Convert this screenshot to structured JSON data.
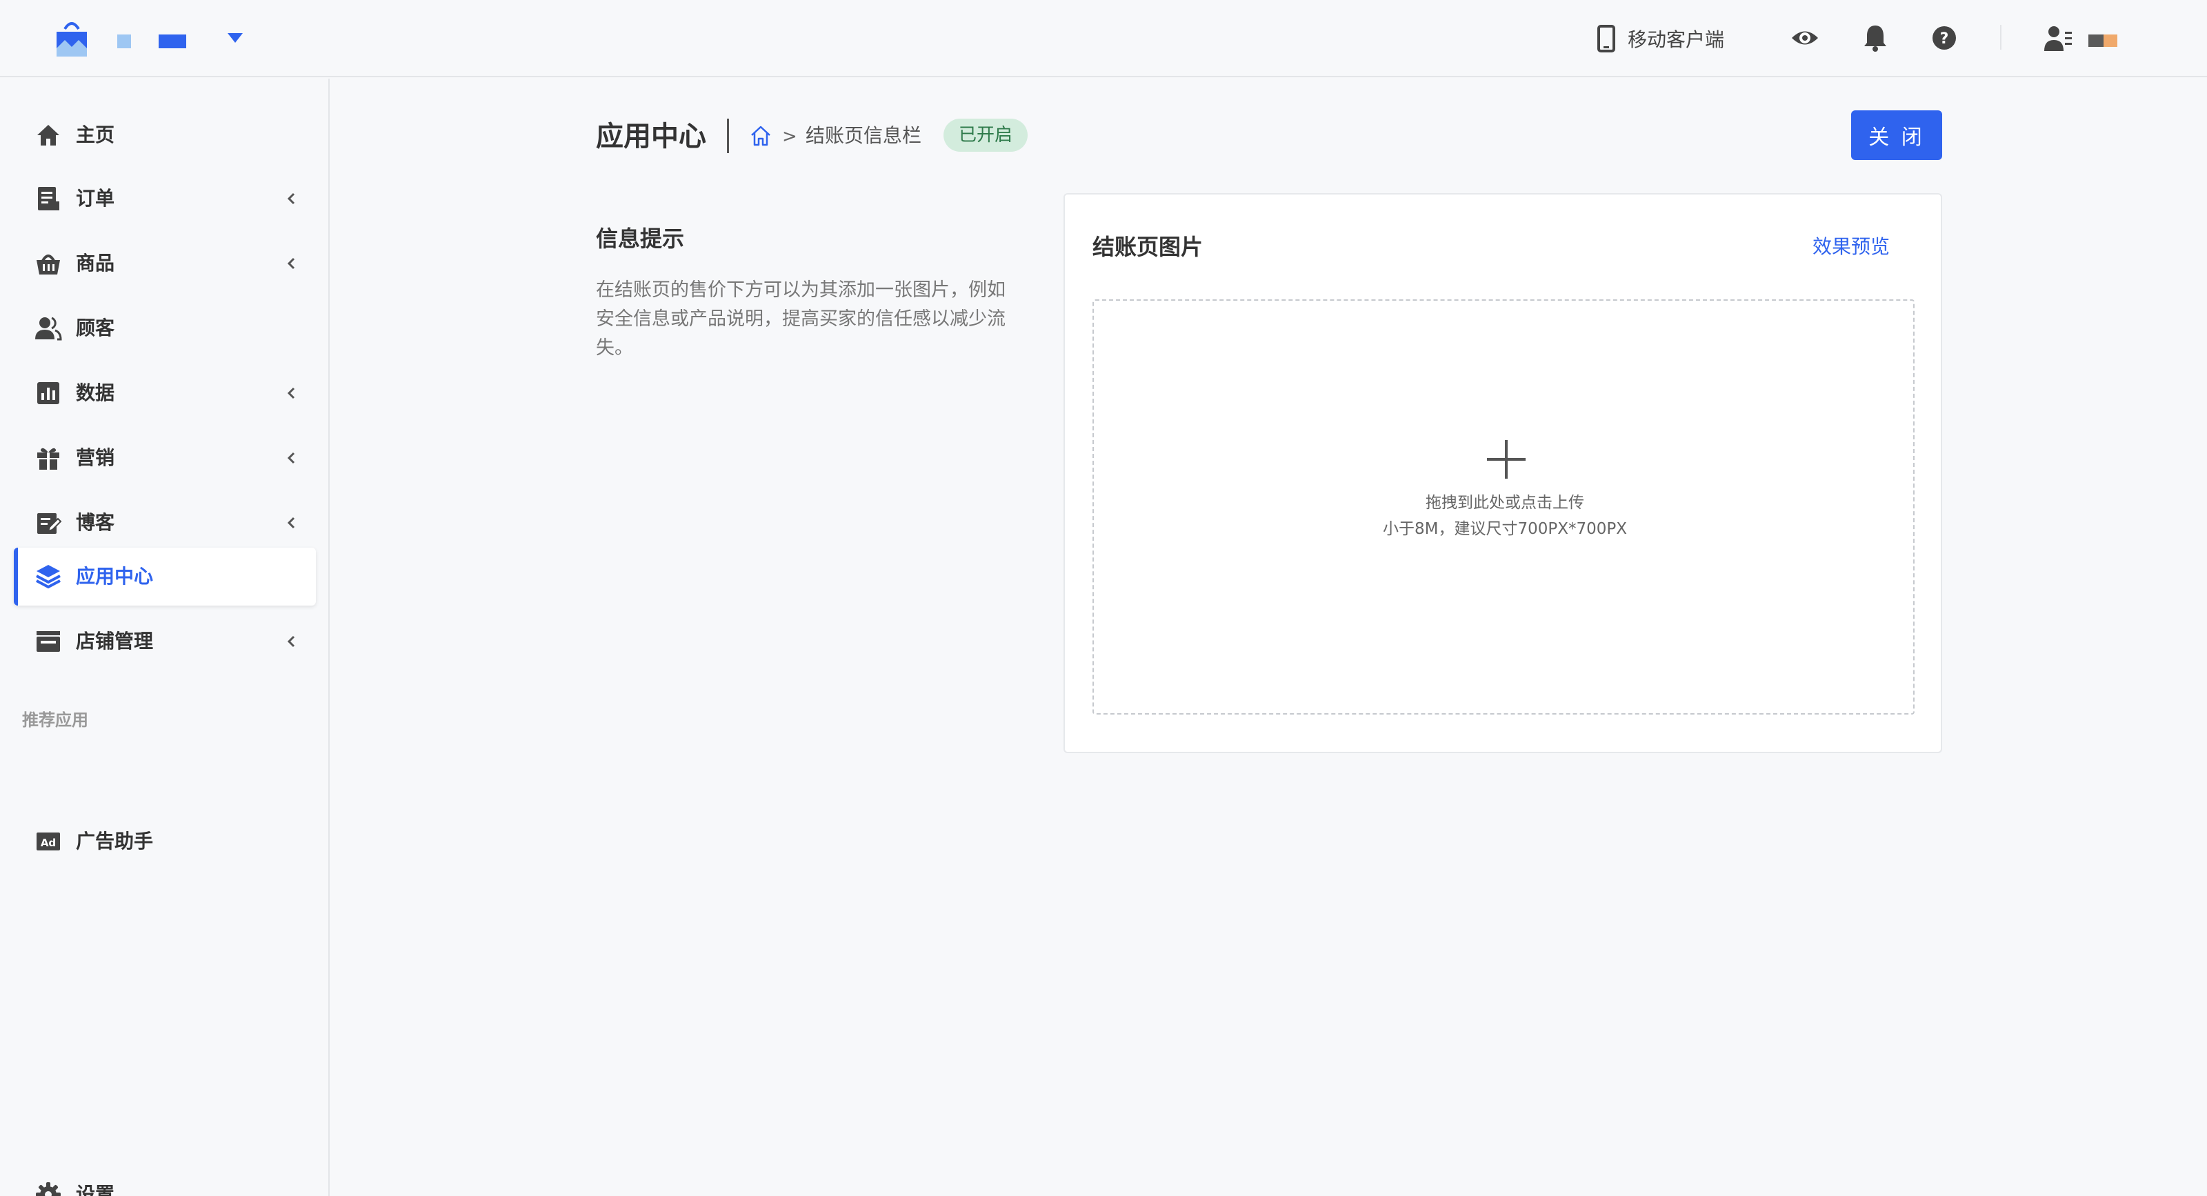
{
  "header": {
    "mobile_client_label": "移动客户端"
  },
  "sidebar": {
    "items": [
      {
        "label": "主页",
        "icon": "home-icon"
      },
      {
        "label": "订单",
        "icon": "order-icon"
      },
      {
        "label": "商品",
        "icon": "basket-icon"
      },
      {
        "label": "顾客",
        "icon": "customers-icon"
      },
      {
        "label": "数据",
        "icon": "chart-icon"
      },
      {
        "label": "营销",
        "icon": "gift-icon"
      },
      {
        "label": "博客",
        "icon": "edit-icon"
      },
      {
        "label": "应用中心",
        "icon": "layers-icon"
      },
      {
        "label": "店铺管理",
        "icon": "store-icon"
      }
    ],
    "section_label": "推荐应用",
    "recommended": [
      {
        "label": "广告助手",
        "icon": "ad-icon"
      }
    ],
    "settings_label": "设置"
  },
  "main": {
    "page_title": "应用中心",
    "breadcrumb_separator": ">",
    "breadcrumb_current": "结账页信息栏",
    "status_badge": "已开启",
    "close_button": "关 闭",
    "info_heading": "信息提示",
    "info_description": "在结账页的售价下方可以为其添加一张图片，例如安全信息或产品说明，提高买家的信任感以减少流失。",
    "card": {
      "title": "结账页图片",
      "preview_link": "效果预览",
      "upload_main": "拖拽到此处或点击上传",
      "upload_sub": "小于8M，建议尺寸700PX*700PX"
    }
  },
  "colors": {
    "accent": "#2f63ee",
    "badge_bg": "#d3ecdd",
    "badge_text": "#2e7a4a",
    "background": "#f7f8fa"
  }
}
